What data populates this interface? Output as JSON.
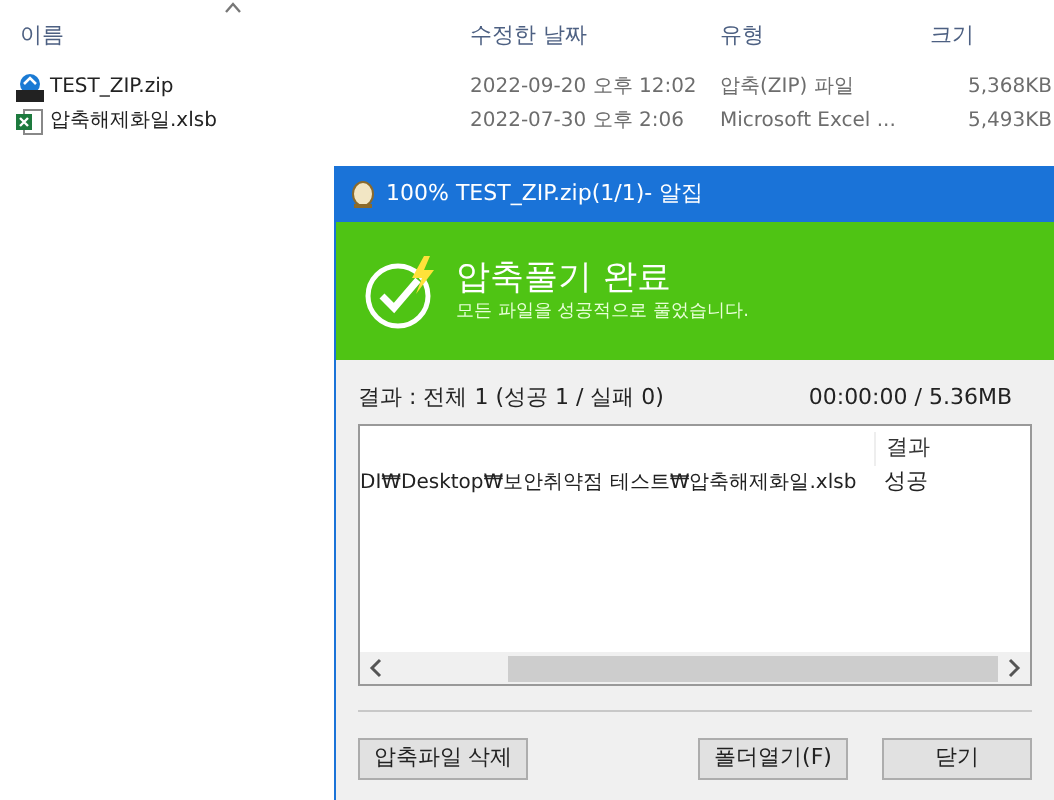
{
  "explorer": {
    "columns": [
      "이름",
      "수정한 날짜",
      "유형",
      "크기"
    ],
    "files": [
      {
        "kind": "zip",
        "name": "TEST_ZIP.zip",
        "modified": "2022-09-20 오후 12:02",
        "type": "압축(ZIP) 파일",
        "size": "5,368KB"
      },
      {
        "kind": "excel",
        "name": "압축해제화일.xlsb",
        "modified": "2022-07-30 오후 2:06",
        "type": "Microsoft Excel ...",
        "size": "5,493KB"
      }
    ]
  },
  "dialog": {
    "title": "100% TEST_ZIP.zip(1/1)- 알집",
    "heading": "압축풀기 완료",
    "message": "모든 파일을 성공적으로 풀었습니다.",
    "summary": "결과 : 전체 1 (성공 1 / 실패 0)",
    "progress": "00:00:00 / 5.36MB",
    "list": {
      "columns": [
        "결과"
      ],
      "rows": [
        {
          "path": "DI₩Desktop₩보안취약점 테스트₩압축해제화일.xlsb",
          "result": "성공"
        }
      ]
    },
    "buttons": [
      "압축파일 삭제",
      "폴더열기(F)",
      "닫기"
    ]
  }
}
